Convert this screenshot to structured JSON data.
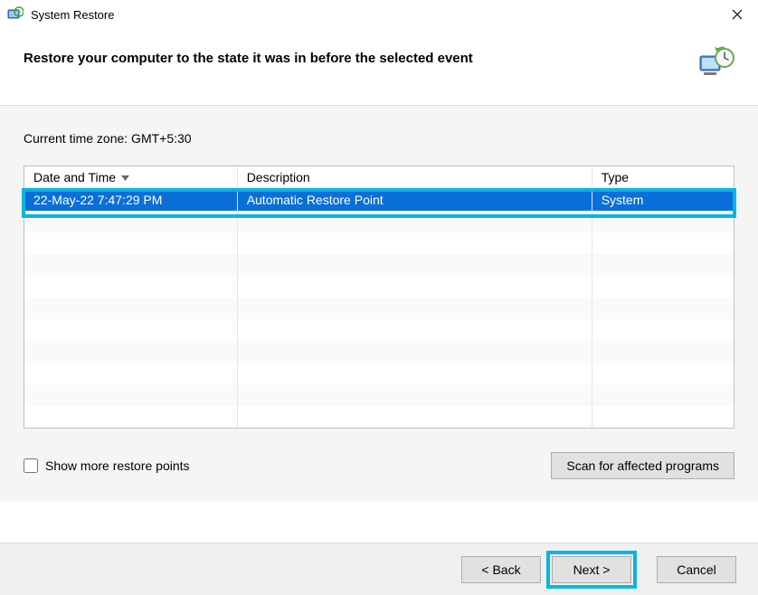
{
  "titlebar": {
    "title": "System Restore"
  },
  "header": {
    "text": "Restore your computer to the state it was in before the selected event"
  },
  "timezone_label": "Current time zone: GMT+5:30",
  "table": {
    "columns": {
      "datetime": "Date and Time",
      "description": "Description",
      "type": "Type"
    },
    "rows": [
      {
        "datetime": "22-May-22 7:47:29 PM",
        "description": "Automatic Restore Point",
        "type": "System",
        "selected": true
      }
    ],
    "empty_row_count": 10
  },
  "show_more": {
    "label": "Show more restore points",
    "checked": false
  },
  "buttons": {
    "scan": "Scan for affected programs",
    "back": "< Back",
    "next": "Next >",
    "cancel": "Cancel"
  }
}
